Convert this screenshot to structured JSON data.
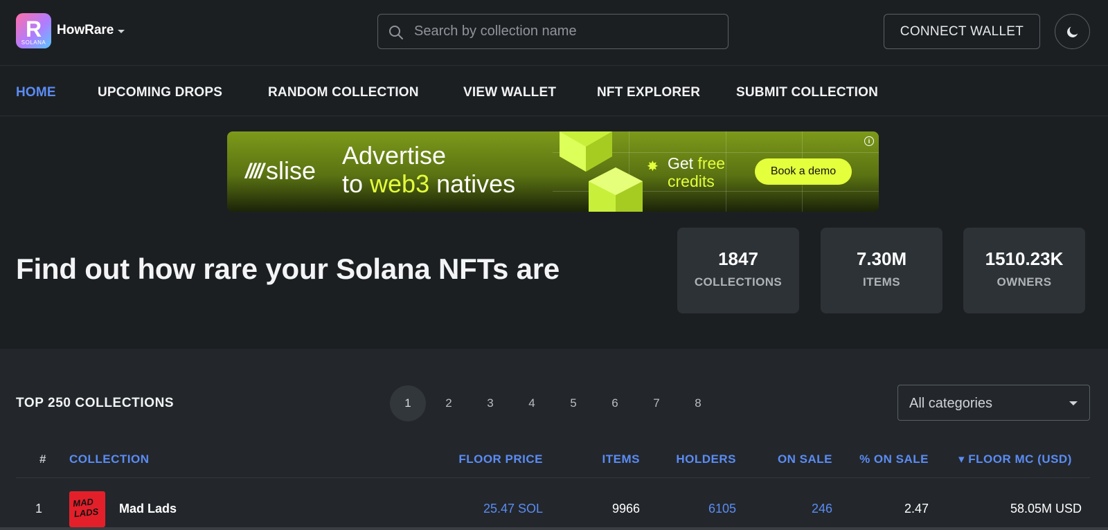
{
  "header": {
    "logo_letter": "R",
    "logo_sub": "SOLANA",
    "brand": "HowRare",
    "search_placeholder": "Search by collection name",
    "connect_label": "CONNECT WALLET",
    "theme_icon": "moon-icon"
  },
  "nav": {
    "items": [
      {
        "label": "HOME",
        "active": true
      },
      {
        "label": "UPCOMING DROPS"
      },
      {
        "label": "RANDOM COLLECTION"
      },
      {
        "label": "VIEW WALLET"
      },
      {
        "label": "NFT EXPLORER"
      },
      {
        "label": "SUBMIT COLLECTION"
      }
    ]
  },
  "ad": {
    "brand_mark": "////",
    "brand": "slise",
    "headline1": "Advertise",
    "headline2_pre": "to ",
    "headline2_hl": "web3",
    "headline2_post": " natives",
    "get_pre": "Get ",
    "get_hl": "free",
    "get_line2": "credits",
    "cta": "Book a demo",
    "info": "i",
    "accent": "#e4ff3c"
  },
  "hero": {
    "title": "Find out how rare your Solana NFTs are",
    "stats": [
      {
        "value": "1847",
        "label": "COLLECTIONS"
      },
      {
        "value": "7.30M",
        "label": "ITEMS"
      },
      {
        "value": "1510.23K",
        "label": "OWNERS"
      }
    ]
  },
  "table": {
    "title": "TOP 250 COLLECTIONS",
    "pages": [
      "1",
      "2",
      "3",
      "4",
      "5",
      "6",
      "7",
      "8"
    ],
    "active_page": "1",
    "category": "All categories",
    "columns": {
      "rank": "#",
      "collection": "COLLECTION",
      "floor_price": "FLOOR PRICE",
      "items": "ITEMS",
      "holders": "HOLDERS",
      "on_sale": "ON SALE",
      "pct_on_sale": "% ON SALE",
      "floor_mc": "FLOOR MC (USD)"
    },
    "sort_indicator": "▾",
    "rows": [
      {
        "rank": "1",
        "icon_text": "MAD LADS",
        "name": "Mad Lads",
        "floor_price": "25.47 SOL",
        "items": "9966",
        "holders": "6105",
        "on_sale": "246",
        "pct_on_sale": "2.47",
        "floor_mc": "58.05M USD"
      }
    ]
  },
  "colors": {
    "accent_blue": "#5b8cf5",
    "background": "#1c1f22",
    "panel": "#2d3236"
  }
}
